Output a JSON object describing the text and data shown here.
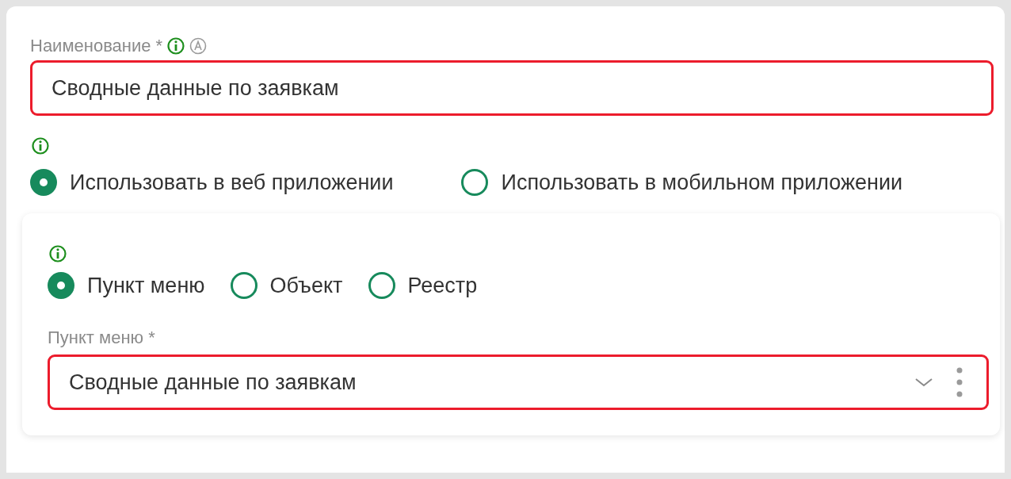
{
  "name_field": {
    "label": "Наименование *",
    "value": "Сводные данные по заявкам",
    "invalid": true,
    "info": true,
    "auto": true
  },
  "usage": {
    "info": true,
    "options": [
      {
        "label": "Использовать в веб приложении",
        "selected": true
      },
      {
        "label": "Использовать в мобильном приложении",
        "selected": false
      }
    ]
  },
  "target": {
    "info": true,
    "options": [
      {
        "label": "Пункт меню",
        "selected": true
      },
      {
        "label": "Объект",
        "selected": false
      },
      {
        "label": "Реестр",
        "selected": false
      }
    ],
    "menu_item_field": {
      "label": "Пункт меню *",
      "value": "Сводные данные по заявкам",
      "invalid": true
    }
  }
}
